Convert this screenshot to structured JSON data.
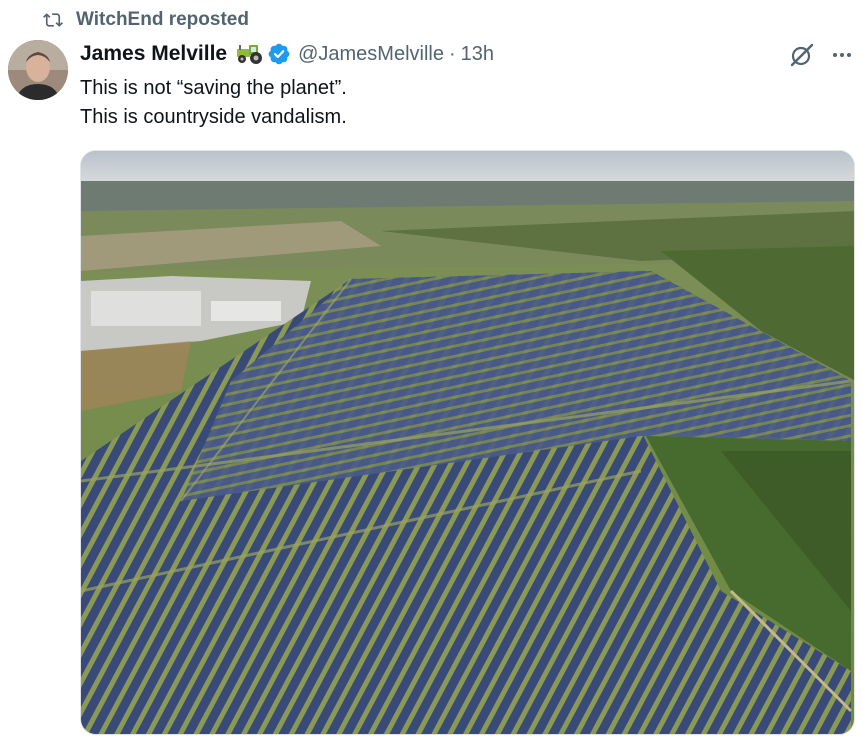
{
  "repost": {
    "label": "WitchEnd reposted",
    "icon": "repost-icon"
  },
  "author": {
    "name": "James Melville",
    "badge_emoji": "tractor-icon",
    "verified": true,
    "handle": "@JamesMelville",
    "separator": "·",
    "time": "13h"
  },
  "post": {
    "lines": [
      "This is not “saving the planet”.",
      "This is countryside vandalism."
    ]
  },
  "actions": {
    "grok_icon": "grok-icon",
    "more_icon": "more-icon"
  },
  "media": {
    "type": "photo",
    "subject": "aerial-solar-farm"
  },
  "colors": {
    "verified": "#1d9bf0",
    "secondary_text": "#536471",
    "primary_text": "#0f1419"
  }
}
